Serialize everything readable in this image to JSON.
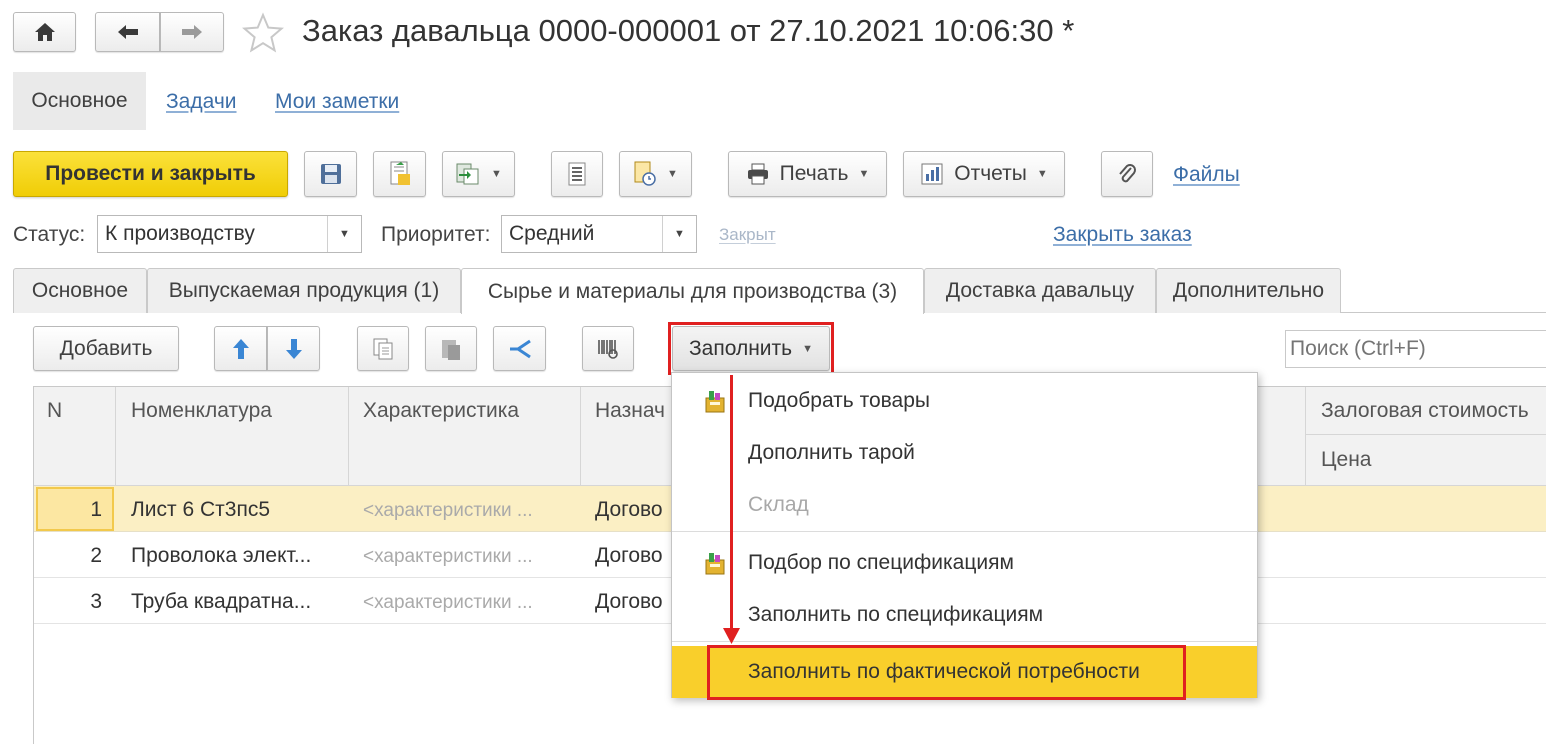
{
  "window": {
    "title": "Заказ давальца 0000-000001 от 27.10.2021 10:06:30 *"
  },
  "nav": {
    "home_icon": "home-icon",
    "back_icon": "arrow-left-icon",
    "forward_icon": "arrow-right-icon",
    "favorite_icon": "star-icon"
  },
  "section_tabs": {
    "main": "Основное",
    "tasks": "Задачи",
    "notes": "Мои заметки"
  },
  "toolbar": {
    "post_close": "Провести и закрыть",
    "print": "Печать",
    "reports": "Отчеты",
    "files": "Файлы"
  },
  "form": {
    "status_label": "Статус:",
    "status_value": "К производству",
    "priority_label": "Приоритет:",
    "priority_value": "Средний",
    "closed_label": "Закрыт",
    "close_order_link": "Закрыть заказ"
  },
  "tabs": [
    {
      "label": "Основное"
    },
    {
      "label": "Выпускаемая продукция (1)"
    },
    {
      "label": "Сырье и материалы для производства (3)"
    },
    {
      "label": "Доставка давальцу"
    },
    {
      "label": "Дополнительно"
    }
  ],
  "table_toolbar": {
    "add": "Добавить",
    "fill": "Заполнить",
    "search_placeholder": "Поиск (Ctrl+F)"
  },
  "table": {
    "columns": {
      "n": "N",
      "nomenclature": "Номенклатура",
      "characteristic": "Характеристика",
      "purpose": "Назнач",
      "pledge": "Залоговая стоимость",
      "price": "Цена"
    },
    "rows": [
      {
        "n": "1",
        "nomenclature": "Лист 6 Ст3пс5",
        "characteristic": "<характеристики ...",
        "purpose": "Догово"
      },
      {
        "n": "2",
        "nomenclature": "Проволока элект...",
        "characteristic": "<характеристики ...",
        "purpose": "Догово"
      },
      {
        "n": "3",
        "nomenclature": "Труба квадратна...",
        "characteristic": "<характеристики ...",
        "purpose": "Догово"
      }
    ]
  },
  "fill_menu": {
    "items": [
      {
        "label": "Подобрать товары",
        "icon": "pick-goods-icon"
      },
      {
        "label": "Дополнить тарой"
      },
      {
        "label": "Склад"
      },
      {
        "label": "Подбор по спецификациям",
        "icon": "pick-goods-icon"
      },
      {
        "label": "Заполнить по спецификациям"
      },
      {
        "label": "Заполнить по фактической потребности"
      }
    ]
  },
  "colors": {
    "primary_button": "#f5d40f",
    "highlight": "#f9cf2b",
    "annotation_red": "#e02020",
    "link": "#3c6ea8",
    "selected_row": "#fbefc4"
  }
}
